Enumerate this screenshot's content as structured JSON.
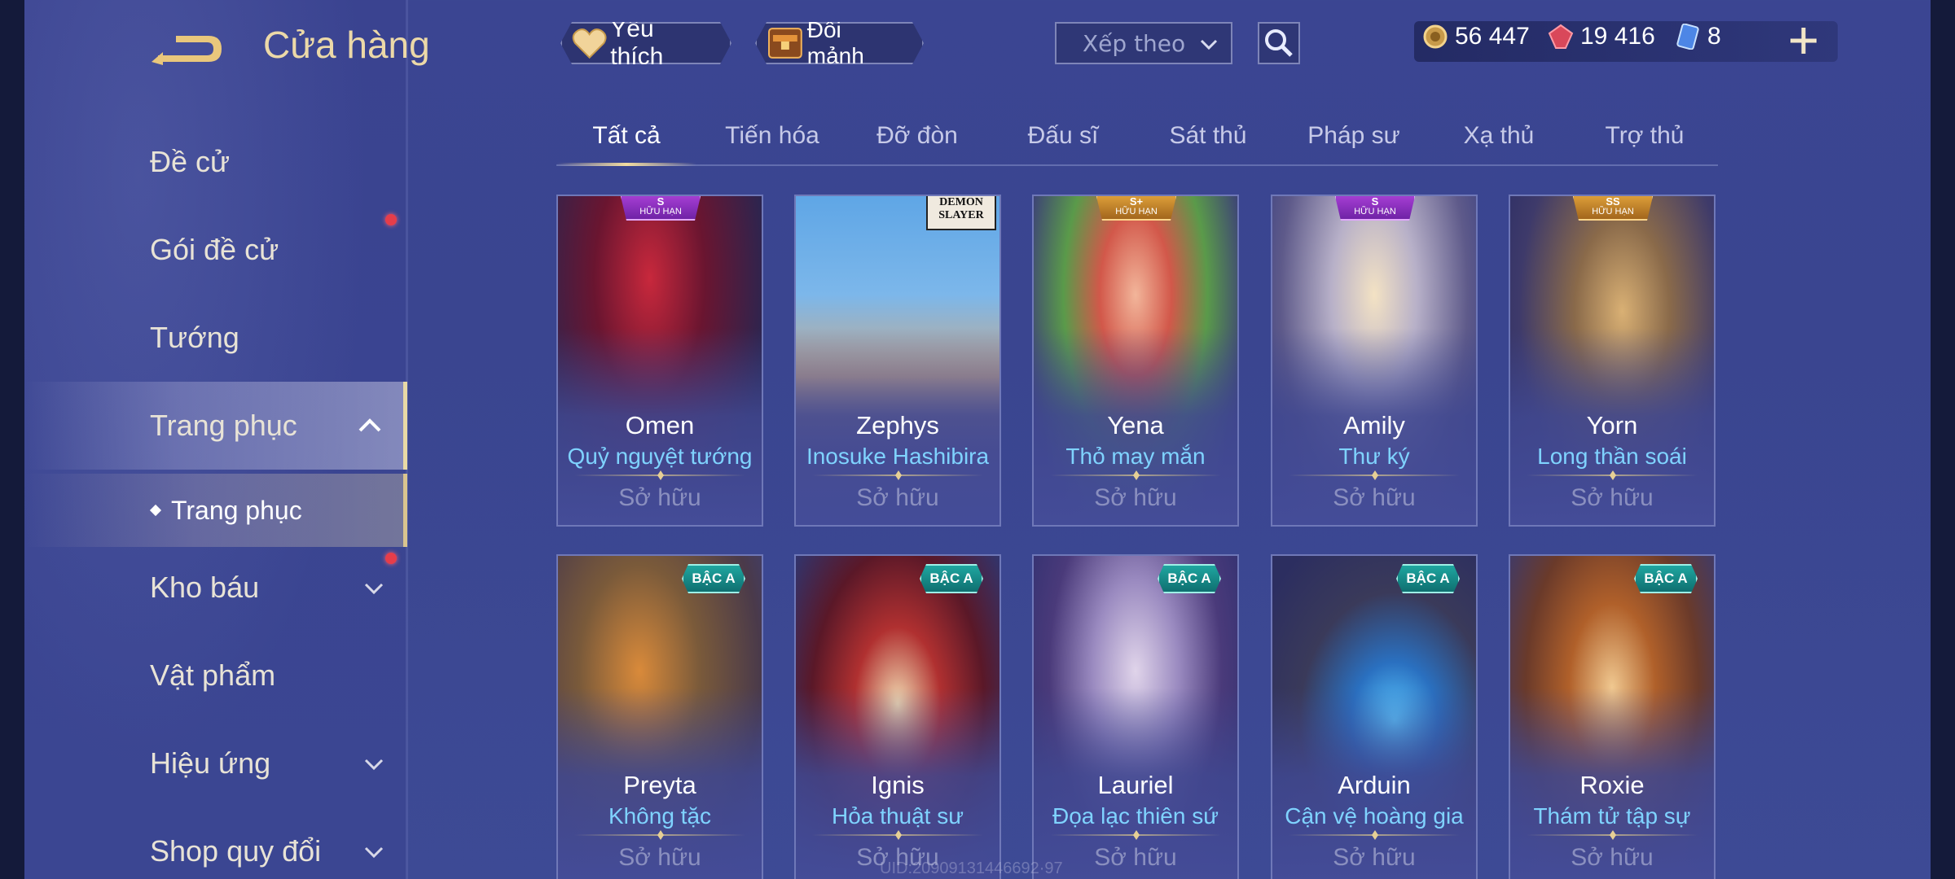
{
  "header": {
    "title": "Cửa hàng",
    "favorite_label": "Yêu thích",
    "exchange_label": "Đổi mảnh",
    "sort_placeholder": "Xếp theo"
  },
  "currency": {
    "gold": "56 447",
    "ruby": "19 416",
    "vouchers": "8"
  },
  "sidebar": {
    "items": [
      {
        "label": "Đề cử"
      },
      {
        "label": "Gói đề cử"
      },
      {
        "label": "Tướng"
      },
      {
        "label": "Trang phục"
      },
      {
        "label": "Kho báu"
      },
      {
        "label": "Vật phẩm"
      },
      {
        "label": "Hiệu ứng"
      },
      {
        "label": "Shop quy đổi"
      }
    ],
    "sub_item": "Trang phục"
  },
  "tabs": [
    "Tất cả",
    "Tiến hóa",
    "Đỡ đòn",
    "Đấu sĩ",
    "Sát thủ",
    "Pháp sư",
    "Xạ thủ",
    "Trợ thủ"
  ],
  "cards": [
    {
      "hero": "Omen",
      "skin": "Quỷ nguyệt tướng",
      "status": "Sở hữu",
      "badge_grade": "S",
      "badge_text": "HỮU HẠN"
    },
    {
      "hero": "Zephys",
      "skin": "Inosuke Hashibira",
      "status": "Sở hữu",
      "brand": "DEMON SLAYER"
    },
    {
      "hero": "Yena",
      "skin": "Thỏ may mắn",
      "status": "Sở hữu",
      "badge_grade": "S+",
      "badge_text": "HỮU HẠN"
    },
    {
      "hero": "Amily",
      "skin": "Thư ký",
      "status": "Sở hữu",
      "badge_grade": "S",
      "badge_text": "HỮU HẠN"
    },
    {
      "hero": "Yorn",
      "skin": "Long thần soái",
      "status": "Sở hữu",
      "badge_grade": "SS",
      "badge_text": "HỮU HẠN"
    },
    {
      "hero": "Preyta",
      "skin": "Không tặc",
      "status": "Sở hữu",
      "badge": "BẬC A"
    },
    {
      "hero": "Ignis",
      "skin": "Hỏa thuật sư",
      "status": "Sở hữu",
      "badge": "BẬC A"
    },
    {
      "hero": "Lauriel",
      "skin": "Đọa lạc thiên sứ",
      "status": "Sở hữu",
      "badge": "BẬC A"
    },
    {
      "hero": "Arduin",
      "skin": "Cận vệ hoàng gia",
      "status": "Sở hữu",
      "badge": "BẬC A"
    },
    {
      "hero": "Roxie",
      "skin": "Thám tử tập sự",
      "status": "Sở hữu",
      "badge": "BẬC A"
    }
  ],
  "watermark": "UID:20909131446692·97",
  "colors": {
    "accent_gold": "#ecd9a8",
    "skin_name": "#7fd3ff",
    "notify_dot": "#e63d4a"
  }
}
